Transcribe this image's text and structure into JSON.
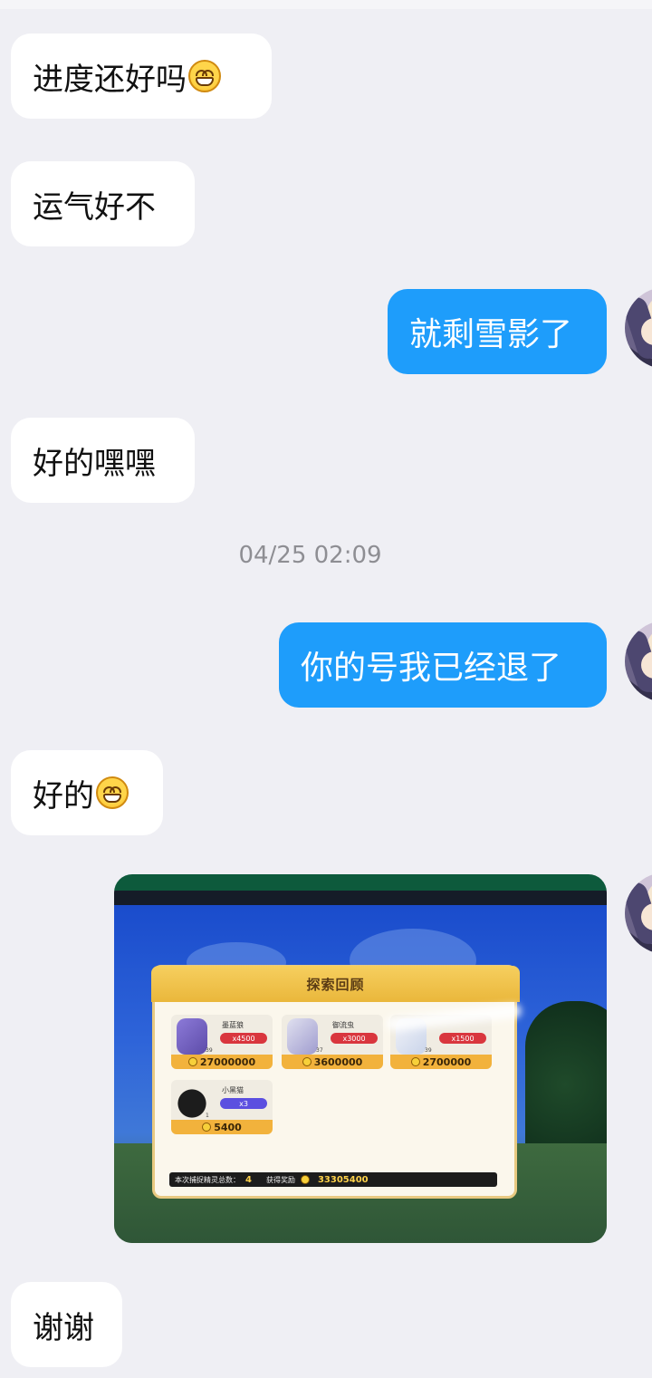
{
  "messages": [
    {
      "text": "进度还好吗",
      "emoji": "grin-emoji"
    },
    {
      "text": "运气好不"
    },
    {
      "text": "就剩雪影了"
    },
    {
      "text": "好的嘿嘿"
    },
    {
      "text": "你的号我已经退了"
    },
    {
      "text": "好的",
      "emoji": "grin-emoji"
    },
    {
      "text": "谢谢"
    }
  ],
  "timestamp": "04/25 02:09",
  "image": {
    "panel_title": "探索回顾",
    "cards": [
      {
        "name": "墨蓝狼",
        "count": "x4500",
        "level": "39",
        "coins": "27000000",
        "tag_color": "#d9363e"
      },
      {
        "name": "御流虫",
        "count": "x3000",
        "level": "37",
        "coins": "3600000",
        "tag_color": "#d9363e"
      },
      {
        "name": "",
        "count": "x1500",
        "level": "39",
        "coins": "2700000",
        "tag_color": "#d9363e"
      },
      {
        "name": "小黑猫",
        "count": "x3",
        "level": "1",
        "coins": "5400",
        "tag_color": "#5b4fe0"
      }
    ],
    "footer_label": "本次捕捉精灵总数：",
    "footer_count": "4",
    "reward_label": "获得奖励",
    "reward_total": "33305400"
  },
  "colors": {
    "incoming_bubble": "#ffffff",
    "outgoing_bubble": "#1e9dfb",
    "background": "#efeff4"
  }
}
